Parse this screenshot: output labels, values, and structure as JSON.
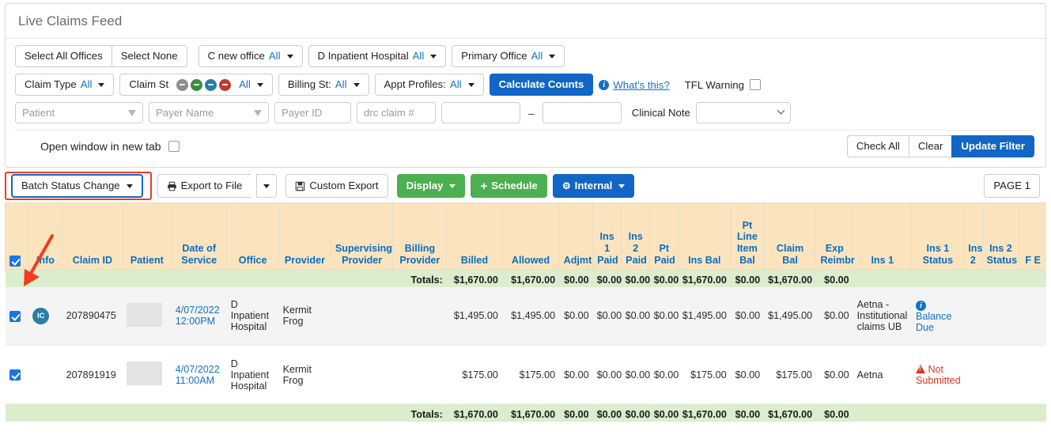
{
  "header": {
    "title": "Live Claims Feed"
  },
  "filters": {
    "office_row": {
      "select_all": "Select All Offices",
      "select_none": "Select None",
      "offices": [
        {
          "name": "C new office",
          "value": "All"
        },
        {
          "name": "D Inpatient Hospital",
          "value": "All"
        },
        {
          "name": "Primary Office",
          "value": "All"
        }
      ]
    },
    "status_row": {
      "claim_type_label": "Claim Type",
      "claim_type_value": "All",
      "claim_st_label": "Claim St",
      "claim_st_value": "All",
      "claim_st_dots": [
        "#8d8d8d",
        "#3d8b40",
        "#2b7ca8",
        "#c0392b"
      ],
      "billing_st_label": "Billing St:",
      "billing_st_value": "All",
      "appt_profiles_label": "Appt Profiles:",
      "appt_profiles_value": "All",
      "calculate_counts": "Calculate Counts",
      "whats_this": "What's this?",
      "tfl_warning": "TFL Warning"
    },
    "search_row": {
      "patient_placeholder": "Patient",
      "payer_name_placeholder": "Payer Name",
      "payer_id_placeholder": "Payer ID",
      "drc_claim_placeholder": "drc claim #",
      "range_from": "",
      "range_to": "",
      "range_sep": "–",
      "clinical_note_label": "Clinical Note",
      "clinical_note_value": ""
    },
    "action_row": {
      "open_new_tab": "Open window in new tab",
      "check_all": "Check All",
      "clear": "Clear",
      "update_filter": "Update Filter"
    }
  },
  "toolbar": {
    "batch_status_change": "Batch Status Change",
    "export_to_file": "Export to File",
    "custom_export": "Custom Export",
    "display": "Display",
    "schedule": "Schedule",
    "internal": "Internal",
    "page_indicator": "PAGE 1",
    "highlight_color": "#f33a1e"
  },
  "table": {
    "columns": [
      {
        "key": "check",
        "label": "",
        "accent": false,
        "align": "left"
      },
      {
        "key": "info",
        "label": "Info",
        "accent": false,
        "align": "left"
      },
      {
        "key": "claimid",
        "label": "Claim ID",
        "accent": false,
        "align": "left"
      },
      {
        "key": "patient",
        "label": "Patient",
        "accent": false,
        "align": "left"
      },
      {
        "key": "dos",
        "label": "Date of Service",
        "accent": true,
        "align": "left"
      },
      {
        "key": "office",
        "label": "Office",
        "accent": false,
        "align": "left"
      },
      {
        "key": "prov",
        "label": "Provider",
        "accent": false,
        "align": "left"
      },
      {
        "key": "supprov",
        "label": "Supervising Provider",
        "accent": false,
        "align": "left"
      },
      {
        "key": "billprov",
        "label": "Billing Provider",
        "accent": false,
        "align": "left"
      },
      {
        "key": "billed",
        "label": "Billed",
        "accent": true,
        "align": "right"
      },
      {
        "key": "allowed",
        "label": "Allowed",
        "accent": true,
        "align": "right"
      },
      {
        "key": "adjmt",
        "label": "Adjmt",
        "accent": true,
        "align": "right"
      },
      {
        "key": "ins1paid",
        "label": "Ins 1 Paid",
        "accent": true,
        "align": "right"
      },
      {
        "key": "ins2paid",
        "label": "Ins 2 Paid",
        "accent": true,
        "align": "right"
      },
      {
        "key": "ptpaid",
        "label": "Pt Paid",
        "accent": true,
        "align": "right"
      },
      {
        "key": "insbal",
        "label": "Ins Bal",
        "accent": true,
        "align": "right"
      },
      {
        "key": "ptlibal",
        "label": "Pt Line Item Bal",
        "accent": true,
        "align": "right"
      },
      {
        "key": "claimbal",
        "label": "Claim Bal",
        "accent": true,
        "align": "right"
      },
      {
        "key": "expreimb",
        "label": "Exp Reimbr",
        "accent": true,
        "align": "right"
      },
      {
        "key": "ins1",
        "label": "Ins 1",
        "accent": true,
        "align": "left"
      },
      {
        "key": "ins1st",
        "label": "Ins 1 Status",
        "accent": true,
        "align": "left"
      },
      {
        "key": "ins2",
        "label": "Ins 2",
        "accent": true,
        "align": "left"
      },
      {
        "key": "ins2st",
        "label": "Ins 2 Status",
        "accent": true,
        "align": "left"
      },
      {
        "key": "fe",
        "label": "F E",
        "accent": true,
        "align": "left"
      }
    ],
    "totals_label": "Totals:",
    "totals": {
      "billed": "$1,670.00",
      "allowed": "$1,670.00",
      "adjmt": "$0.00",
      "ins1paid": "$0.00",
      "ins2paid": "$0.00",
      "ptpaid": "$0.00",
      "insbal": "$1,670.00",
      "ptlibal": "$0.00",
      "claimbal": "$1,670.00",
      "expreimb": "$0.00"
    },
    "rows": [
      {
        "checked": true,
        "info_badge": "IC",
        "claim_id": "207890475",
        "patient": "",
        "dos_date": "4/07/2022",
        "dos_time": "12:00PM",
        "office": "D Inpatient Hospital",
        "provider": "Kermit Frog",
        "supervising_provider": "",
        "billing_provider": "",
        "billed": "$1,495.00",
        "allowed": "$1,495.00",
        "adjmt": "$0.00",
        "ins1paid": "$0.00",
        "ins2paid": "$0.00",
        "ptpaid": "$0.00",
        "insbal": "$1,495.00",
        "ptlibal": "$0.00",
        "claimbal": "$1,495.00",
        "expreimb": "$0.00",
        "ins1": "Aetna - Institutional claims UB",
        "ins1_status": "Balance Due",
        "ins1_status_kind": "link",
        "ins2": "",
        "ins2_status": ""
      },
      {
        "checked": true,
        "info_badge": "",
        "claim_id": "207891919",
        "patient": "",
        "dos_date": "4/07/2022",
        "dos_time": "11:00AM",
        "office": "D Inpatient Hospital",
        "provider": "Kermit Frog",
        "supervising_provider": "",
        "billing_provider": "",
        "billed": "$175.00",
        "allowed": "$175.00",
        "adjmt": "$0.00",
        "ins1paid": "$0.00",
        "ins2paid": "$0.00",
        "ptpaid": "$0.00",
        "insbal": "$175.00",
        "ptlibal": "$0.00",
        "claimbal": "$175.00",
        "expreimb": "$0.00",
        "ins1": "Aetna",
        "ins1_status": "Not Submitted",
        "ins1_status_kind": "warn",
        "ins2": "",
        "ins2_status": ""
      }
    ]
  }
}
